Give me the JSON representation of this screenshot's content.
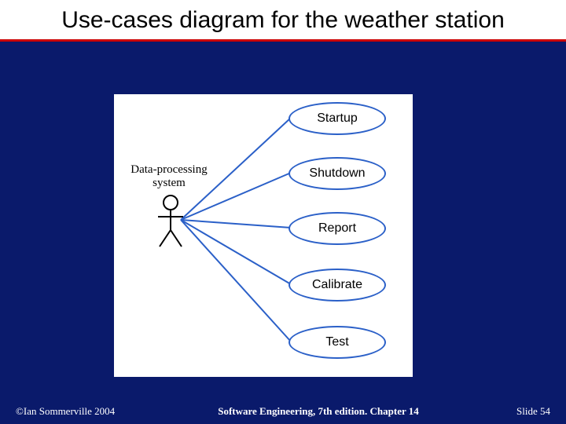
{
  "title": "Use-cases diagram for the weather station",
  "actor": {
    "label_line1": "Data-processing",
    "label_line2": "system"
  },
  "usecases": [
    {
      "label": "Startup"
    },
    {
      "label": "Shutdown"
    },
    {
      "label": "Report"
    },
    {
      "label": "Calibrate"
    },
    {
      "label": "Test"
    }
  ],
  "footer": {
    "copyright": "©Ian Sommerville 2004",
    "book": "Software Engineering, 7th edition. Chapter 14",
    "slide": "Slide  54"
  }
}
